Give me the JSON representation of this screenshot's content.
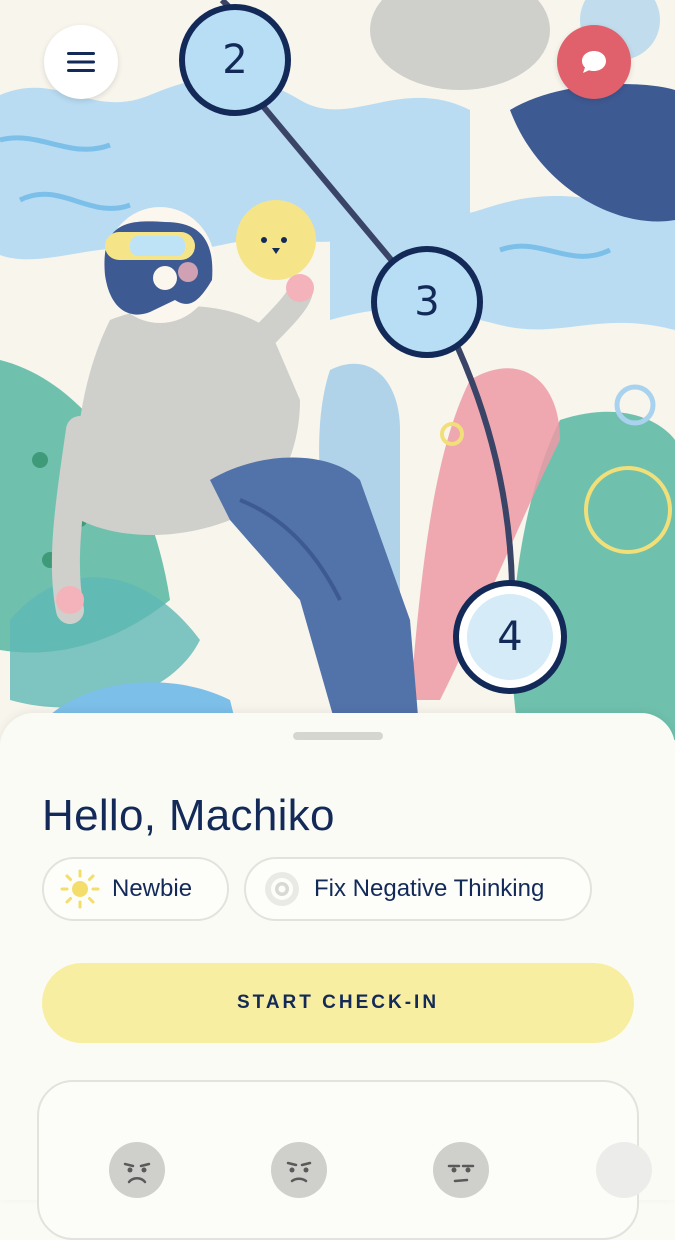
{
  "header": {
    "menu_icon": "hamburger-menu-icon",
    "chat_icon": "chat-bubble-icon",
    "accent_chat": "#e0616b"
  },
  "journey": {
    "nodes": [
      "2",
      "3",
      "4"
    ],
    "current": "4",
    "node_fill": "#b7def4",
    "node_stroke": "#132a59"
  },
  "greeting": "Hello, Machiko",
  "chips": [
    {
      "label": "Newbie",
      "icon": "sun-icon"
    },
    {
      "label": "Fix Negative Thinking",
      "icon": "target-icon"
    }
  ],
  "start_button": {
    "label": "START CHECK-IN",
    "color": "#f8eea1"
  },
  "moods": [
    {
      "icon": "sad-face-icon"
    },
    {
      "icon": "worried-face-icon"
    },
    {
      "icon": "neutral-face-icon"
    }
  ],
  "colors": {
    "text": "#132a59",
    "background": "#fbfbf6"
  }
}
